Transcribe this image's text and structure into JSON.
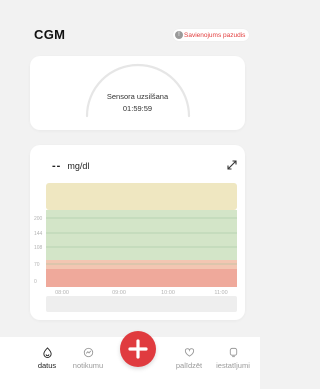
{
  "header": {
    "title": "CGM",
    "notice_label": "Savienojums pazudis",
    "notice_icon": "!"
  },
  "sensor": {
    "label": "Sensora uzsilšana",
    "timer": "01:59:59"
  },
  "reading": {
    "value": "--",
    "unit": "mg/dl"
  },
  "chart_data": {
    "type": "line",
    "x_ticks": [
      "08:00",
      "09:00",
      "10:00",
      "11:00"
    ],
    "y_ticks": [
      200,
      144,
      108,
      70,
      0
    ],
    "bands": [
      {
        "name": "high",
        "color": "#efe7c1"
      },
      {
        "name": "target",
        "color": "#d3e5c8"
      },
      {
        "name": "low",
        "color": "#f3c6b2"
      },
      {
        "name": "very-low",
        "color": "#efa99b"
      }
    ],
    "series": []
  },
  "nav": {
    "items": [
      {
        "label": "datus",
        "icon": "home-icon",
        "active": true
      },
      {
        "label": "notikumu",
        "icon": "events-icon",
        "active": false
      },
      {
        "label": "palīdzēt",
        "icon": "heart-icon",
        "active": false
      },
      {
        "label": "iestatījumi",
        "icon": "settings-icon",
        "active": false
      }
    ],
    "add_icon": "plus-icon"
  }
}
